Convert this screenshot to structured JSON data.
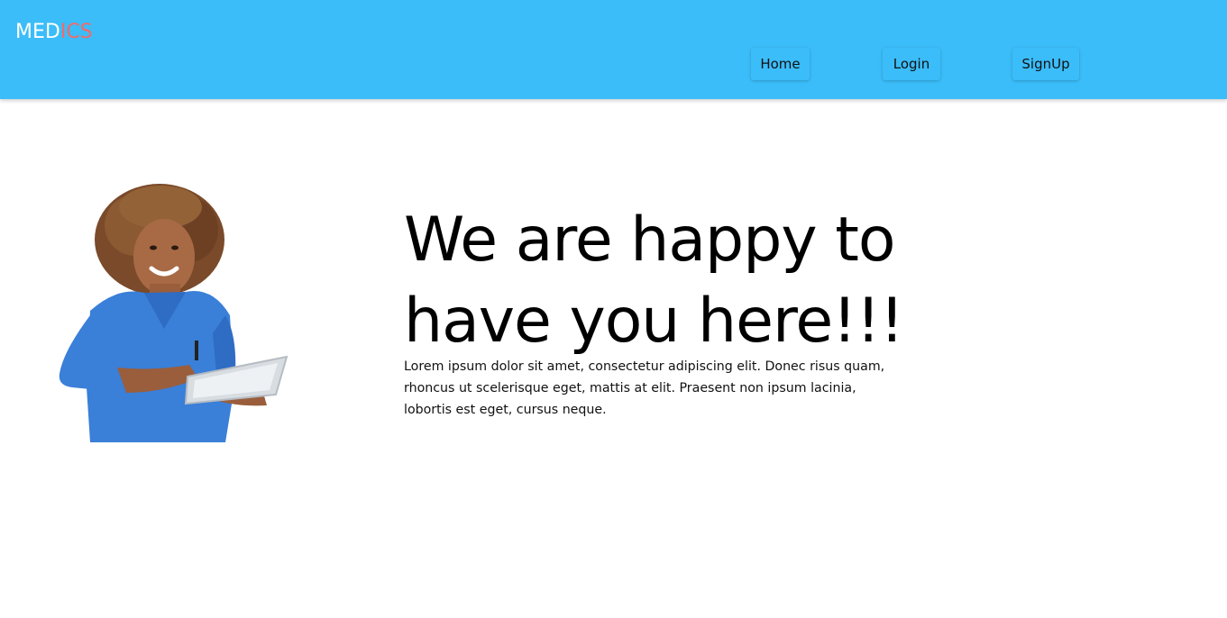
{
  "header": {
    "logo_part1": "MED",
    "logo_part2": "ICS",
    "background_color": "#3bbdf9",
    "logo_accent_color": "#f06b6b"
  },
  "nav": {
    "items": [
      {
        "label": "Home"
      },
      {
        "label": "Login"
      },
      {
        "label": "SignUp"
      }
    ]
  },
  "hero": {
    "image_icon": "nurse-with-tablet-photo",
    "headline": "We are happy to have you here!!!",
    "body": "Lorem ipsum dolor sit amet, consectetur adipiscing elit. Donec risus quam, rhoncus ut scelerisque eget, mattis at elit. Praesent non ipsum lacinia, lobortis est eget, cursus neque."
  }
}
